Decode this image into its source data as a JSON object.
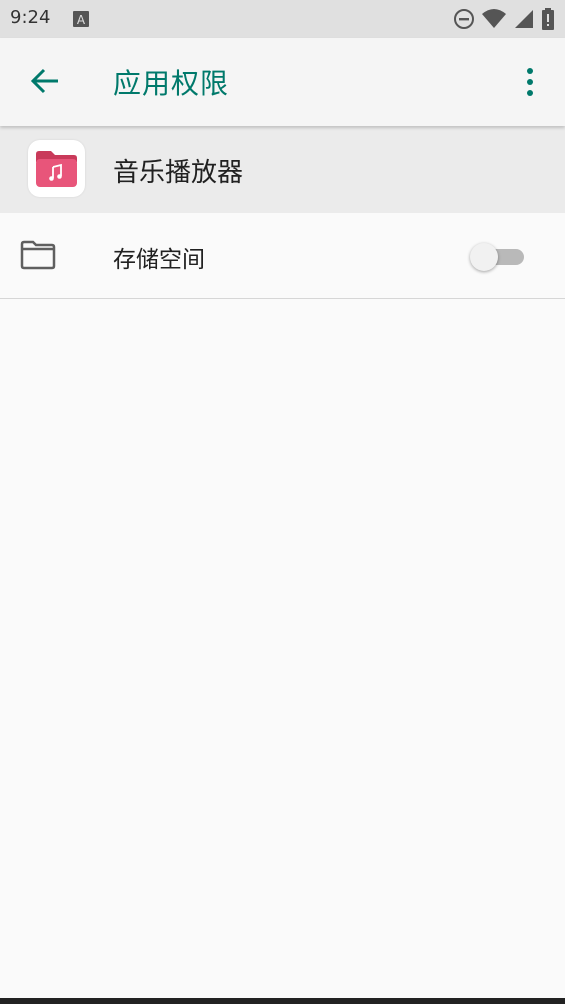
{
  "status_bar": {
    "time": "9:24",
    "icons": [
      "text-notification-icon",
      "do-not-disturb-icon",
      "wifi-icon",
      "cell-signal-icon",
      "battery-icon"
    ]
  },
  "app_bar": {
    "title": "应用权限",
    "back_icon": "arrow-back-icon",
    "menu_icon": "more-vert-icon"
  },
  "app": {
    "name": "音乐播放器",
    "icon": "music-folder-icon"
  },
  "permissions": [
    {
      "label": "存储空间",
      "icon": "folder-icon",
      "enabled": false
    }
  ],
  "colors": {
    "accent": "#00796b",
    "app_icon_pink": "#e05070"
  }
}
